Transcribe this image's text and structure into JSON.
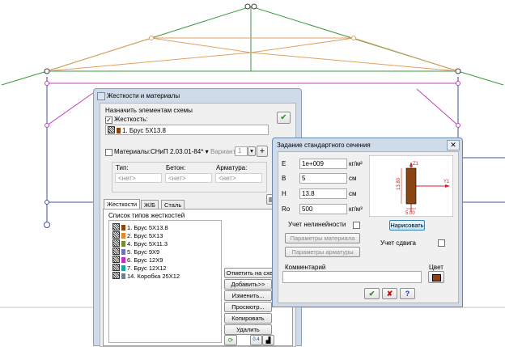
{
  "main_dialog": {
    "title": "Жесткости и материалы",
    "assign_label": "Назначить элементам схемы",
    "stiffness_checkbox": "Жесткость:",
    "stiffness_value": "1. Брус 5Х13.8",
    "materials_checkbox": "Материалы:",
    "snip": "СНиП 2.03.01-84*",
    "variant_label": "Вариант",
    "variant_value": "1",
    "col_type": "Тип:",
    "col_concrete": "Бетон:",
    "col_rebar": "Арматура:",
    "none": "<нет>",
    "tabs": [
      "Жесткости",
      "Ж/Б",
      "Сталь"
    ],
    "list_title": "Список типов жесткостей",
    "list": [
      {
        "label": "1. Брус 5Х13.8",
        "color": "#8b4513"
      },
      {
        "label": "2. Брус 5Х13",
        "color": "#e08830"
      },
      {
        "label": "4. Брус 5Х11.3",
        "color": "#7a8a30"
      },
      {
        "label": "5. Брус 9Х9",
        "color": "#7070c0"
      },
      {
        "label": "6. Брус 12Х9",
        "color": "#c030c0"
      },
      {
        "label": "7. Брус 12Х12",
        "color": "#20a0a0"
      },
      {
        "label": "14. Коробка 25Х12",
        "color": "#708090"
      }
    ],
    "buttons": [
      "Отметить на схеме",
      "Добавить>>",
      "Изменить...",
      "Просмотр...",
      "Копировать",
      "Удалить"
    ]
  },
  "section_dialog": {
    "title": "Задание стандартного сечения",
    "E_label": "E",
    "E_value": "1e+009",
    "E_unit": "кг/м²",
    "B_label": "B",
    "B_value": "5",
    "B_unit": "см",
    "H_label": "H",
    "H_value": "13.8",
    "H_unit": "см",
    "Ro_label": "Ro",
    "Ro_value": "500",
    "Ro_unit": "кг/м³",
    "nonlinear_label": "Учет нелинейности",
    "material_params": "Параметры материала",
    "rebar_params": "Параметры арматуры",
    "draw_button": "Нарисовать",
    "shear_label": "Учет сдвига",
    "comment_label": "Комментарий",
    "color_label": "Цвет",
    "section_color": "#8b4513",
    "preview_z": "Z1",
    "preview_y": "Y1",
    "preview_h": "13.80",
    "preview_b": "5.00"
  }
}
